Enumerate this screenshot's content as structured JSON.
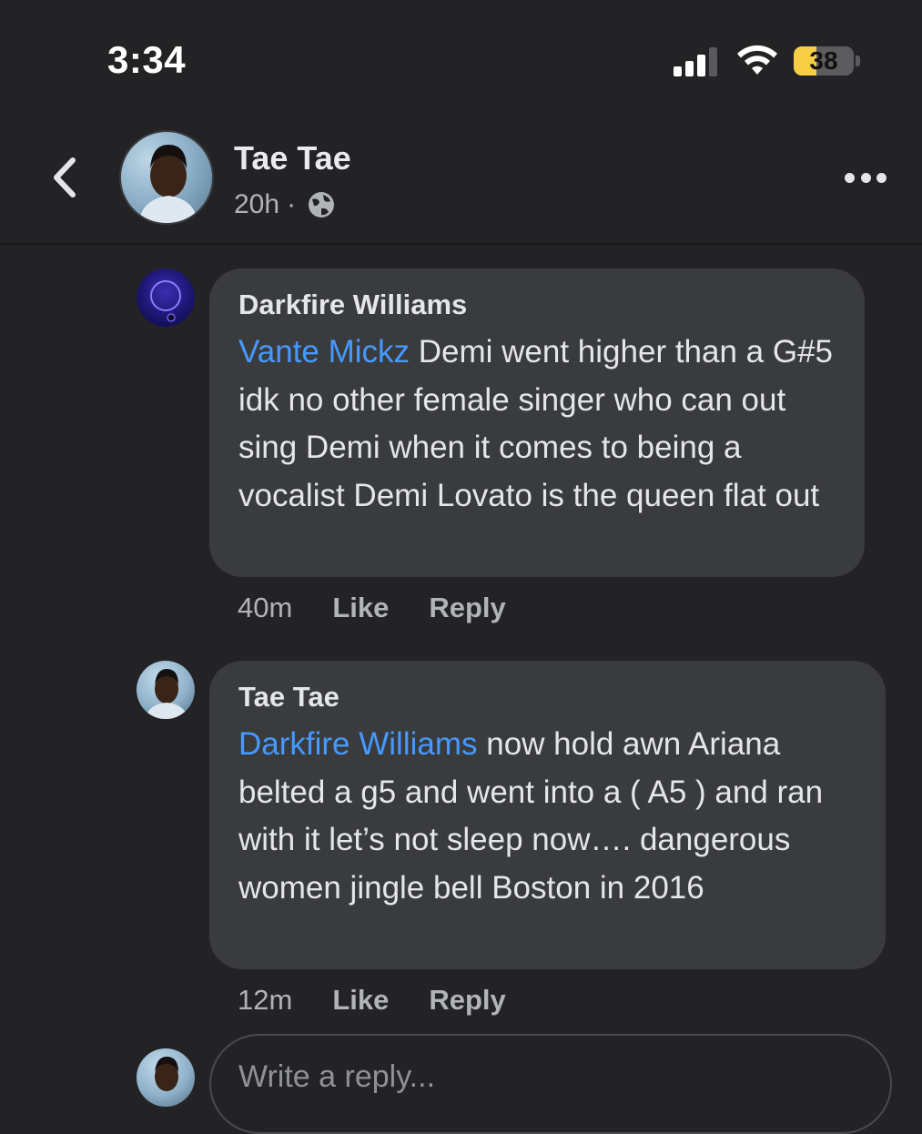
{
  "status_bar": {
    "time": "3:34",
    "battery": "38",
    "battery_level": 0.38,
    "signal_bars_active": 3,
    "signal_bars_total": 4
  },
  "header": {
    "name": "Tae Tae",
    "time": "20h",
    "separator": "·",
    "privacy_icon": "globe-icon"
  },
  "comments": [
    {
      "author": "Darkfire Williams",
      "mention": "Vante Mickz",
      "text": " Demi went higher than a G#5 idk no other female singer who can out sing Demi when it comes to being a vocalist Demi Lovato is the queen flat out",
      "time": "40m",
      "like": "Like",
      "reply": "Reply"
    },
    {
      "author": "Tae Tae",
      "mention": "Darkfire Williams",
      "text": " now hold awn Ariana belted a g5 and went into a ( A5 ) and ran with it let’s not sleep now…. dangerous women jingle bell Boston in 2016",
      "time": "12m",
      "like": "Like",
      "reply": "Reply"
    }
  ],
  "reply_input": {
    "placeholder": "Write a reply..."
  },
  "colors": {
    "background": "#232325",
    "bubble": "#3a3b3d",
    "mention": "#4599ff",
    "secondary_text": "#b0b3b8",
    "battery": "#f7ce46"
  }
}
